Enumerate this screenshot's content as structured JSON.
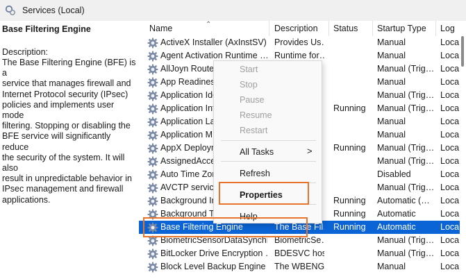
{
  "window": {
    "title": "Services (Local)"
  },
  "left_pane": {
    "service_title": "Base Filtering Engine",
    "description_label": "Description:",
    "description": "The Base Filtering Engine (BFE) is a\nservice that manages firewall and\nInternet Protocol security (IPsec)\npolicies and implements user mode\nfiltering. Stopping or disabling the\nBFE service will significantly reduce\nthe security of the system. It will also\nresult in unpredictable behavior in\nIPsec management and firewall\napplications."
  },
  "columns": {
    "name": "Name",
    "description": "Description",
    "status": "Status",
    "startup": "Startup Type",
    "log": "Log"
  },
  "rows": [
    {
      "name": "ActiveX Installer (AxInstSV)",
      "description": "Provides Us…",
      "status": "",
      "startup": "Manual",
      "log": "Loca"
    },
    {
      "name": "Agent Activation Runtime …",
      "description": "Runtime for…",
      "status": "",
      "startup": "Manual",
      "log": "Loca"
    },
    {
      "name": "AllJoyn Router",
      "description": "",
      "status": "",
      "startup": "Manual (Trig…",
      "log": "Loca"
    },
    {
      "name": "App Readiness",
      "description": "",
      "status": "",
      "startup": "Manual",
      "log": "Loca"
    },
    {
      "name": "Application Ide",
      "description": "",
      "status": "",
      "startup": "Manual (Trig…",
      "log": "Loca"
    },
    {
      "name": "Application Inf",
      "description": "",
      "status": "Running",
      "startup": "Manual (Trig…",
      "log": "Loca"
    },
    {
      "name": "Application La",
      "description": "",
      "status": "",
      "startup": "Manual",
      "log": "Loca"
    },
    {
      "name": "Application M",
      "description": "",
      "status": "",
      "startup": "Manual",
      "log": "Loca"
    },
    {
      "name": "AppX Deploym",
      "description": "",
      "status": "Running",
      "startup": "Manual (Trig…",
      "log": "Loca"
    },
    {
      "name": "AssignedAcces",
      "description": "",
      "status": "",
      "startup": "Manual (Trig…",
      "log": "Loca"
    },
    {
      "name": "Auto Time Zon",
      "description": "",
      "status": "",
      "startup": "Disabled",
      "log": "Loca"
    },
    {
      "name": "AVCTP service",
      "description": "",
      "status": "",
      "startup": "Manual (Trig…",
      "log": "Loca"
    },
    {
      "name": "Background In",
      "description": "",
      "status": "Running",
      "startup": "Automatic (…",
      "log": "Loca"
    },
    {
      "name": "Background Ta",
      "description": "",
      "status": "Running",
      "startup": "Automatic",
      "log": "Loca"
    },
    {
      "name": "Base Filtering Engine",
      "description": "The Base Fil…",
      "status": "Running",
      "startup": "Automatic",
      "log": "Loca"
    },
    {
      "name": "BiometricSensorDataSynchr…",
      "description": "BiometricSe…",
      "status": "",
      "startup": "Manual (Trig…",
      "log": "Loca"
    },
    {
      "name": "BitLocker Drive Encryption …",
      "description": "BDESVC hos…",
      "status": "",
      "startup": "Manual (Trig…",
      "log": "Loca"
    },
    {
      "name": "Block Level Backup Engine …",
      "description": "The WBENG…",
      "status": "",
      "startup": "Manual",
      "log": "Loca"
    }
  ],
  "context_menu": {
    "start": "Start",
    "stop": "Stop",
    "pause": "Pause",
    "resume": "Resume",
    "restart": "Restart",
    "all_tasks": "All Tasks",
    "all_tasks_arrow": ">",
    "refresh": "Refresh",
    "properties": "Properties",
    "help": "Help"
  },
  "colors": {
    "selection": "#0a64d6",
    "highlight_box": "#e8732a"
  }
}
